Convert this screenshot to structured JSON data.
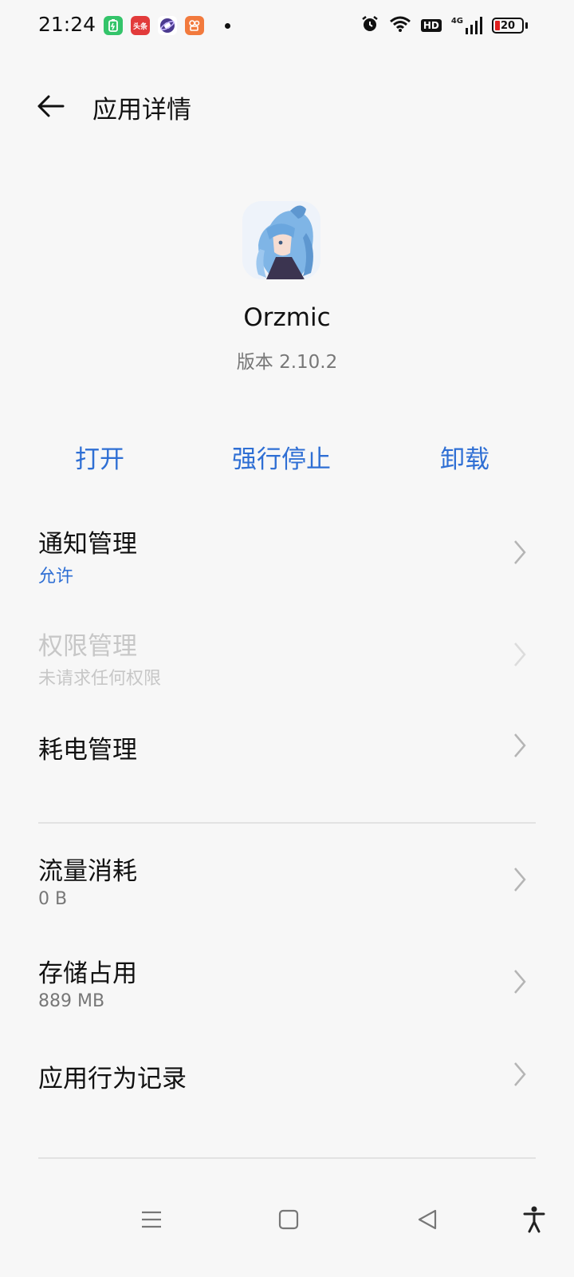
{
  "status_bar": {
    "time": "21:24",
    "notification_icons": [
      "battery-saver-icon",
      "toutiao-icon",
      "browser-icon",
      "kuaishou-icon"
    ],
    "toutiao_text": "头条",
    "network_label": "4G",
    "hd_label": "HD",
    "battery_level": "20"
  },
  "header": {
    "title": "应用详情"
  },
  "app": {
    "name": "Orzmic",
    "version": "版本 2.10.2"
  },
  "actions": {
    "open": "打开",
    "force_stop": "强行停止",
    "uninstall": "卸载"
  },
  "settings": [
    {
      "title": "通知管理",
      "subtitle": "允许",
      "enabled": true
    },
    {
      "title": "权限管理",
      "subtitle": "未请求任何权限",
      "enabled": false
    },
    {
      "title": "耗电管理",
      "subtitle": "",
      "enabled": true
    },
    {
      "title": "流量消耗",
      "subtitle": "0 B",
      "enabled": true
    },
    {
      "title": "存储占用",
      "subtitle": "889 MB",
      "enabled": true
    },
    {
      "title": "应用行为记录",
      "subtitle": "",
      "enabled": true
    }
  ],
  "nav_bar": {
    "icons": [
      "menu-icon",
      "home-icon",
      "back-icon",
      "accessibility-icon"
    ]
  },
  "colors": {
    "accent": "#2f6fd4",
    "background": "#f7f7f7",
    "disabled": "#c7c7c7"
  }
}
